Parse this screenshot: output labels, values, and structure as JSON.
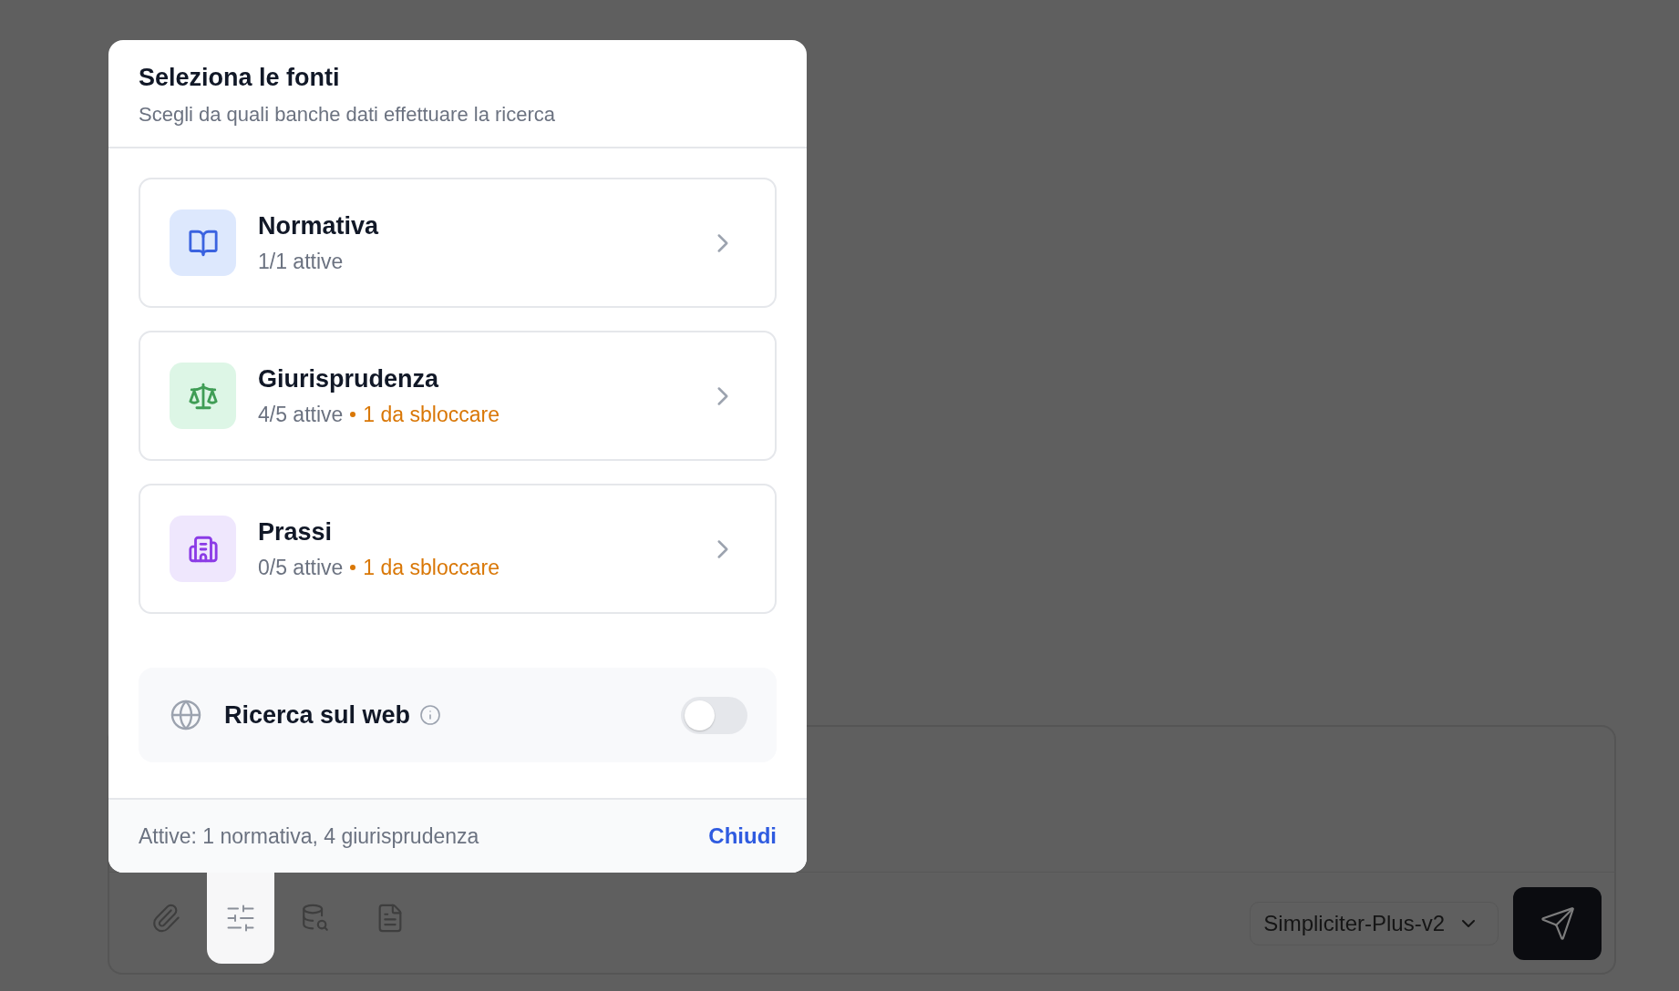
{
  "dialog": {
    "title": "Seleziona le fonti",
    "subtitle": "Scegli da quali banche dati effettuare la ricerca",
    "sources": [
      {
        "kind": "book",
        "name": "Normativa",
        "status": "1/1 attive"
      },
      {
        "kind": "scale",
        "name": "Giurisprudenza",
        "status": "4/5 attive",
        "locked": "1 da sbloccare"
      },
      {
        "kind": "building",
        "name": "Prassi",
        "status": "0/5 attive",
        "locked": "1 da sbloccare"
      }
    ],
    "web_search": {
      "label": "Ricerca sul web",
      "on": false
    },
    "footer": {
      "summary": "Attive: 1 normativa, 4 giurisprudenza",
      "close": "Chiudi"
    }
  },
  "composer": {
    "tools": [
      {
        "kind": "attach",
        "selected": false
      },
      {
        "kind": "sliders",
        "selected": true
      },
      {
        "kind": "database-search",
        "selected": false
      },
      {
        "kind": "document",
        "selected": false
      }
    ],
    "model": "Simpliciter-Plus-v2"
  }
}
